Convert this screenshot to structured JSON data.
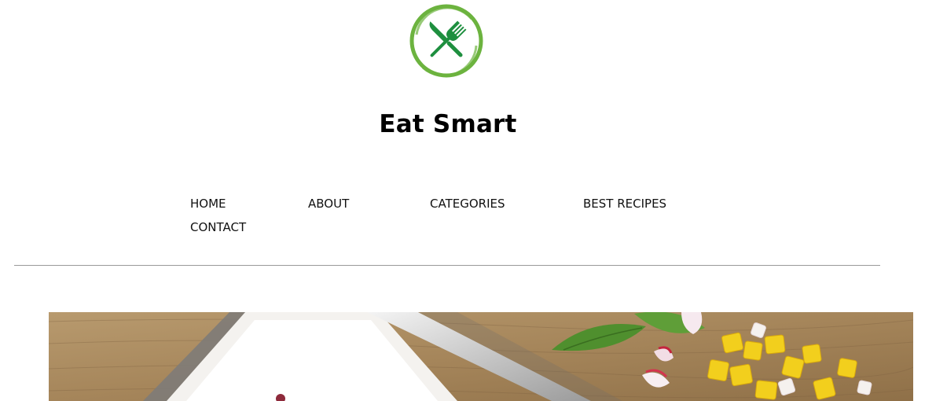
{
  "header": {
    "logo_icon": "fork-knife-icon",
    "logo_colors": {
      "ring": "#6cb33f",
      "utensils": "#1e8f3f"
    },
    "site_title": "Eat Smart"
  },
  "nav": {
    "items": [
      {
        "label": "HOME"
      },
      {
        "label": "ABOUT"
      },
      {
        "label": "CATEGORIES"
      },
      {
        "label": "BEST RECIPES"
      },
      {
        "label": "CONTACT"
      }
    ]
  },
  "hero": {
    "image": "food-photo"
  }
}
